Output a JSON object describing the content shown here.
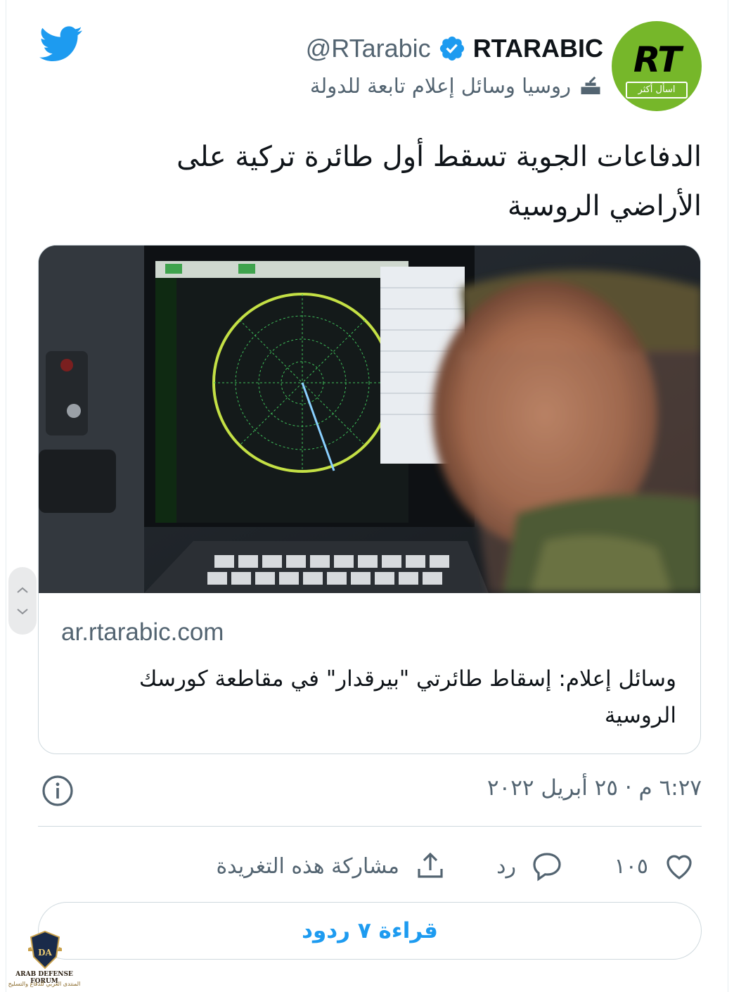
{
  "header": {
    "twitter_logo": "twitter-bird-icon",
    "display_name": "RTARABIC",
    "handle": "@RTarabic",
    "verified": true,
    "account_label": "روسيا وسائل إعلام تابعة للدولة",
    "avatar": {
      "logo": "RT",
      "tagline": "اسأل أكثر"
    }
  },
  "tweet": {
    "text": "الدفاعات الجوية تسقط أول طائرة تركية على الأراضي الروسية"
  },
  "card": {
    "image_alt": "radar-operator-photo",
    "domain": "ar.rtarabic.com",
    "title": "وسائل إعلام: إسقاط طائرتي \"بيرقدار\" في مقاطعة كورسك الروسية"
  },
  "meta": {
    "timestamp": "٦:٢٧ م · ٢٥ أبريل ٢٠٢٢",
    "info_icon": "info-icon"
  },
  "actions": {
    "like_count": "١٠٥",
    "reply_label": "رد",
    "share_label": "مشاركة هذه التغريدة"
  },
  "read_replies": {
    "label": "قراءة ٧ ردود"
  },
  "watermark": {
    "title": "ARAB DEFENSE FORUM",
    "subtitle": "المنتدى العربي للدفاع والتسليح",
    "emblem": "DA"
  },
  "colors": {
    "accent": "#1d9bf0",
    "secondary_text": "#536471",
    "border": "#cfd9de",
    "rt_green": "#76b72a"
  }
}
